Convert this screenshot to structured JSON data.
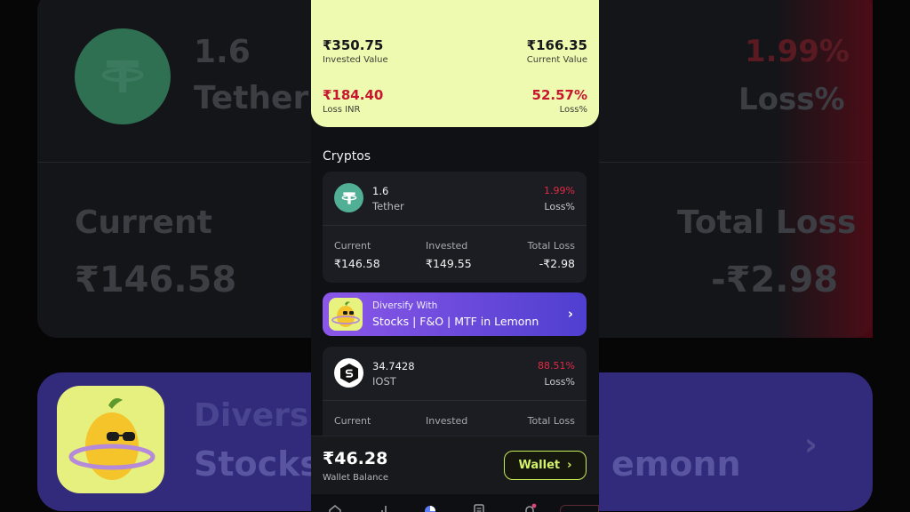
{
  "background": {
    "quantity": "1.6",
    "coin_name": "Tether",
    "loss_pct": "1.99%",
    "loss_pct_label": "Loss%",
    "current_label": "Current",
    "current_value": "₹146.58",
    "total_loss_label": "Total Loss",
    "total_loss_value": "-₹2.98",
    "promo_line1": "Diversify",
    "promo_line2": "Stocks",
    "promo_tail": "emonn"
  },
  "summary": {
    "invested_value": "₹350.75",
    "invested_label": "Invested Value",
    "current_value": "₹166.35",
    "current_label": "Current Value",
    "loss_inr": "₹184.40",
    "loss_inr_label": "Loss INR",
    "loss_pct": "52.57%",
    "loss_pct_label": "Loss%"
  },
  "section_title": "Cryptos",
  "holdings": [
    {
      "quantity": "1.6",
      "name": "Tether",
      "pct": "1.99%",
      "pct_label": "Loss%",
      "icon": "tether-icon",
      "metrics": [
        {
          "label": "Current",
          "value": "₹146.58"
        },
        {
          "label": "Invested",
          "value": "₹149.55"
        },
        {
          "label": "Total Loss",
          "value": "-₹2.98"
        }
      ]
    },
    {
      "quantity": "34.7428",
      "name": "IOST",
      "pct": "88.51%",
      "pct_label": "Loss%",
      "icon": "iost-icon",
      "metrics": [
        {
          "label": "Current",
          "value": ""
        },
        {
          "label": "Invested",
          "value": ""
        },
        {
          "label": "Total Loss",
          "value": ""
        }
      ]
    }
  ],
  "promo": {
    "line1": "Diversify With",
    "line2": "Stocks | F&O | MTF in Lemonn"
  },
  "wallet": {
    "balance": "₹46.28",
    "balance_label": "Wallet Balance",
    "button_label": "Wallet"
  },
  "colors": {
    "summary_bg": "#eefab0",
    "loss_red": "#e02a45",
    "accent_green": "#c7ee55",
    "promo_purple": "#6b4bdc",
    "tether_green": "#50af95"
  }
}
